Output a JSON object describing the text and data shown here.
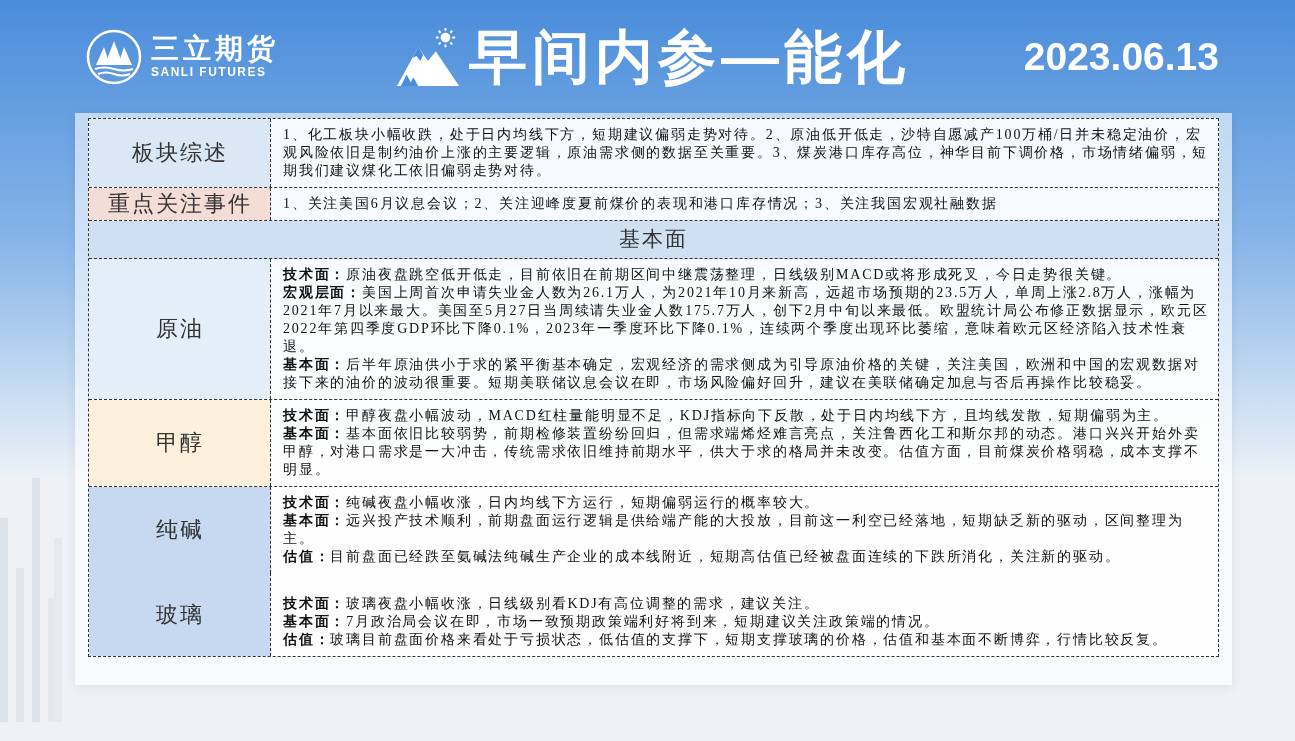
{
  "header": {
    "logo_name": "三立期货",
    "logo_subtitle": "SANLI FUTURES",
    "title": "早间内参—能化",
    "date": "2023.06.13"
  },
  "overview": [
    {
      "label": "板块综述",
      "color": "#dae8f5",
      "text": "1、化工板块小幅收跌，处于日内均线下方，短期建议偏弱走势对待。2、原油低开低走，沙特自愿减产100万桶/日并未稳定油价，宏观风险依旧是制约油价上涨的主要逻辑，原油需求侧的数据至关重要。3、煤炭港口库存高位，神华目前下调价格，市场情绪偏弱，短期我们建议煤化工依旧偏弱走势对待。"
    },
    {
      "label": "重点关注事件",
      "color": "#f4dcd7",
      "text": "1、关注美国6月议息会议；2、关注迎峰度夏前煤价的表现和港口库存情况；3、关注我国宏观社融数据"
    }
  ],
  "section_heading": "基本面",
  "commodities": [
    {
      "label": "原油",
      "color": "#e3eef9",
      "paragraphs": [
        "**技术面：**原油夜盘跳空低开低走，目前依旧在前期区间中继震荡整理，日线级别MACD或将形成死叉，今日走势很关键。",
        "**宏观层面：**美国上周首次申请失业金人数为26.1万人，为2021年10月来新高，远超市场预期的23.5万人，单周上涨2.8万人，涨幅为2021年7月以来最大。美国至5月27日当周续请失业金人数175.7万人，创下2月中旬以来最低。欧盟统计局公布修正数据显示，欧元区2022年第四季度GDP环比下降0.1%，2023年一季度环比下降0.1%，连续两个季度出现环比萎缩，意味着欧元区经济陷入技术性衰退。",
        "**基本面：**后半年原油供小于求的紧平衡基本确定，宏观经济的需求侧成为引导原油价格的关键，关注美国，欧洲和中国的宏观数据对接下来的油价的波动很重要。短期美联储议息会议在即，市场风险偏好回升，建议在美联储确定加息与否后再操作比较稳妥。"
      ]
    },
    {
      "label": "甲醇",
      "color": "#fdf0dc",
      "paragraphs": [
        "**技术面：**甲醇夜盘小幅波动，MACD红柱量能明显不足，KDJ指标向下反散，处于日内均线下方，且均线发散，短期偏弱为主。",
        "**基本面：**基本面依旧比较弱势，前期检修装置纷纷回归，但需求端烯烃难言亮点，关注鲁西化工和斯尔邦的动态。港口兴兴开始外卖甲醇，对港口需求是一大冲击，传统需求依旧维持前期水平，供大于求的格局并未改变。估值方面，目前煤炭价格弱稳，成本支撑不明显。"
      ]
    },
    {
      "label": "纯碱",
      "color": "#c6d9f1",
      "paragraphs": [
        "**技术面：**纯碱夜盘小幅收涨，日内均线下方运行，短期偏弱运行的概率较大。",
        "**基本面：**远兴投产技术顺利，前期盘面运行逻辑是供给端产能的大投放，目前这一利空已经落地，短期缺乏新的驱动，区间整理为主。",
        "**估值：**目前盘面已经跌至氨碱法纯碱生产企业的成本线附近，短期高估值已经被盘面连续的下跌所消化，关注新的驱动。"
      ]
    },
    {
      "label": "玻璃",
      "color": "#c6d9f1",
      "paragraphs": [
        "**技术面：**玻璃夜盘小幅收涨，日线级别看KDJ有高位调整的需求，建议关注。",
        "**基本面：**7月政治局会议在即，市场一致预期政策端利好将到来，短期建议关注政策端的情况。",
        "**估值：**玻璃目前盘面价格来看处于亏损状态，低估值的支撑下，短期支撑玻璃的价格，估值和基本面不断博弈，行情比较反复。"
      ]
    }
  ]
}
